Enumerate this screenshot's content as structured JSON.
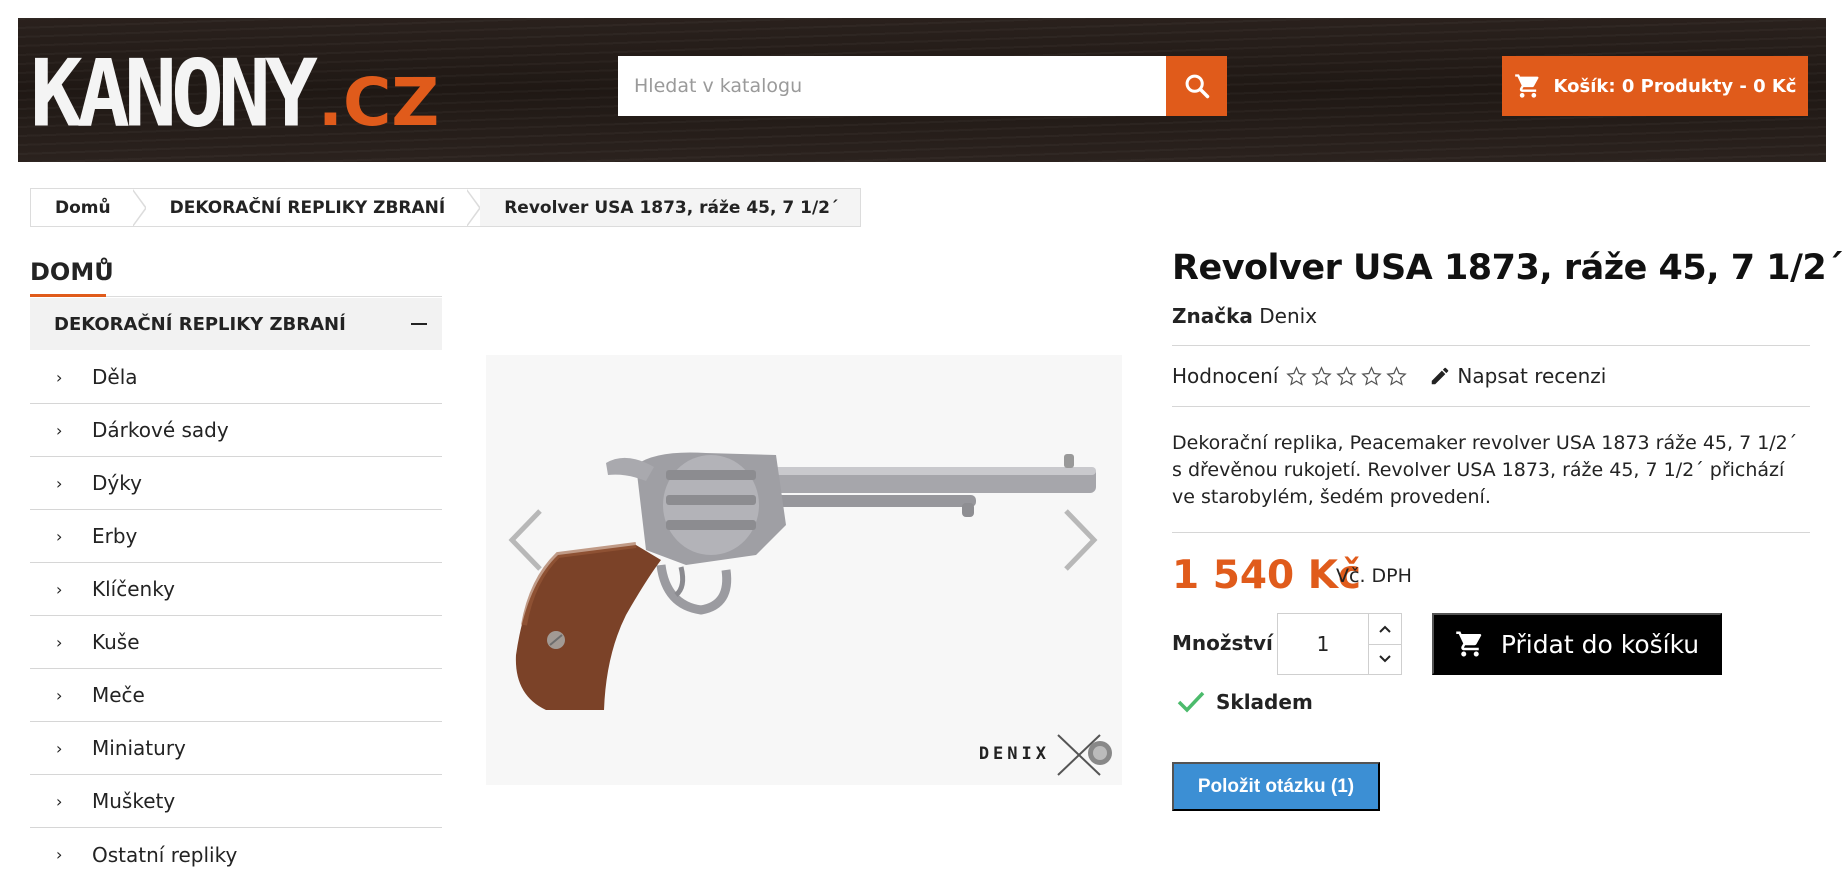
{
  "header": {
    "logo_main": "KANONY",
    "logo_tld": ".CZ",
    "search_placeholder": "Hledat v katalogu",
    "cart_label": "Košík: 0 Produkty - 0 Kč"
  },
  "breadcrumb": [
    "Domů",
    "DEKORAČNÍ REPLIKY ZBRANÍ",
    "Revolver USA 1873, ráže 45, 7 1/2´"
  ],
  "sidebar": {
    "title": "DOMŮ",
    "category": "DEKORAČNÍ REPLIKY ZBRANÍ",
    "items": [
      "Děla",
      "Dárkové sady",
      "Dýky",
      "Erby",
      "Klíčenky",
      "Kuše",
      "Meče",
      "Miniatury",
      "Muškety",
      "Ostatní repliky"
    ]
  },
  "image": {
    "watermark": "DENIX"
  },
  "product": {
    "title": "Revolver USA 1873, ráže 45, 7 1/2´",
    "brand_label": "Značka",
    "brand": "Denix",
    "rating_label": "Hodnocení",
    "rating_value": 0,
    "rating_max": 5,
    "review_link": "Napsat recenzi",
    "description": "Dekorační replika, Peacemaker revolver USA 1873 ráže 45, 7 1/2´ s dřevěnou rukojetí. Revolver USA 1873, ráže 45, 7 1/2´ přichází ve starobylém, šedém provedení.",
    "price": "1 540 Kč",
    "vat": "Vč. DPH",
    "qty_label": "Množství",
    "qty_value": "1",
    "add_to_cart": "Přidat do košíku",
    "stock": "Skladem",
    "ask_button": "Položit otázku (1)"
  },
  "colors": {
    "accent": "#e05b1b",
    "ask_blue": "#3c8fd4",
    "stock_green": "#4cbb6c"
  }
}
